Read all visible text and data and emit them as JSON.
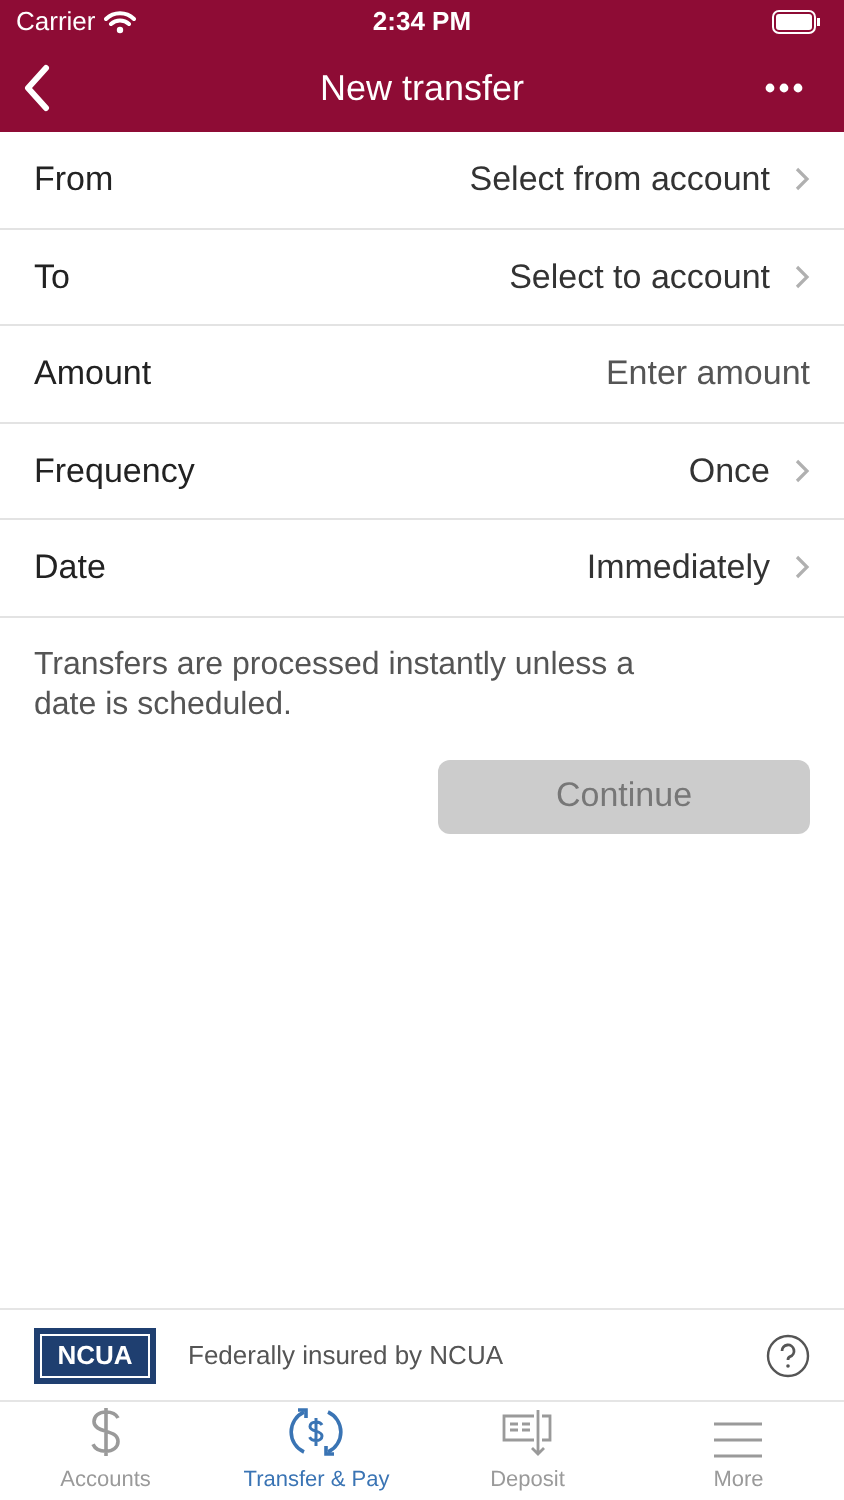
{
  "status_bar": {
    "carrier": "Carrier",
    "time": "2:34 PM"
  },
  "nav_bar": {
    "title": "New transfer"
  },
  "form_rows": [
    {
      "kind": "select",
      "label": "From",
      "value": "Select from account"
    },
    {
      "kind": "select",
      "label": "To",
      "value": "Select to account"
    },
    {
      "kind": "input",
      "label": "Amount",
      "placeholder": "Enter amount"
    },
    {
      "kind": "select",
      "label": "Frequency",
      "value": "Once"
    },
    {
      "kind": "select",
      "label": "Date",
      "value": "Immediately"
    }
  ],
  "note": "Transfers are processed instantly unless a date is scheduled.",
  "continue_button": {
    "label": "Continue",
    "disabled": true
  },
  "footer": {
    "logo_text": "NCUA",
    "text": "Federally insured by NCUA"
  },
  "tab_bar": [
    {
      "kind": "accounts",
      "label": "Accounts",
      "selected": false
    },
    {
      "kind": "transfer",
      "label": "Transfer & Pay",
      "selected": true
    },
    {
      "kind": "deposit",
      "label": "Deposit",
      "selected": false
    },
    {
      "kind": "more",
      "label": "More",
      "selected": false
    }
  ]
}
